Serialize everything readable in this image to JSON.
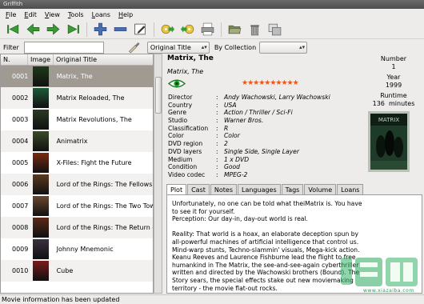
{
  "window": {
    "title": "Griffith"
  },
  "menu": [
    "File",
    "Edit",
    "View",
    "Tools",
    "Loans",
    "Help"
  ],
  "toolbar": [
    "first-icon",
    "prev-icon",
    "next-icon",
    "last-icon",
    "add-icon",
    "delete-icon",
    "edit-icon",
    "loan-icon",
    "return-icon",
    "print-icon",
    "open-folder-icon",
    "trash-icon",
    "window-icon"
  ],
  "filter": {
    "label": "Filter",
    "value": "",
    "field": "Original Title",
    "by_label": "By Collection",
    "collection": ""
  },
  "list": {
    "headers": [
      "N.",
      "Image",
      "Original Title"
    ],
    "rows": [
      {
        "num": "0001",
        "title": "Matrix, The",
        "color": "#1d3a1a"
      },
      {
        "num": "0002",
        "title": "Matrix Reloaded, The",
        "color": "#1f5a38"
      },
      {
        "num": "0003",
        "title": "Matrix Revolutions, The",
        "color": "#2a3a24"
      },
      {
        "num": "0004",
        "title": "Animatrix",
        "color": "#3a4a2a"
      },
      {
        "num": "0005",
        "title": "X-Files: Fight the Future",
        "color": "#7a2a10"
      },
      {
        "num": "0006",
        "title": "Lord of the Rings: The Fellowship",
        "color": "#5a3a20"
      },
      {
        "num": "0007",
        "title": "Lord of the Rings: The Two Towe",
        "color": "#6a4830"
      },
      {
        "num": "0008",
        "title": "Lord of the Rings: The Return of",
        "color": "#5a2a18"
      },
      {
        "num": "0009",
        "title": "Johnny Mnemonic",
        "color": "#3a3040"
      },
      {
        "num": "0010",
        "title": "Cube",
        "color": "#7a1a1a"
      }
    ]
  },
  "movie": {
    "title": "Matrix, The",
    "original_title": "Matrix, The",
    "rating_stars": "★★★★★★★★★★",
    "details": [
      {
        "k": "Director",
        "v": "Andy Wachowski, Larry Wachowski"
      },
      {
        "k": "Country",
        "v": "USA"
      },
      {
        "k": "Genre",
        "v": "Action / Thriller / Sci-Fi"
      },
      {
        "k": "Studio",
        "v": "Warner Bros."
      },
      {
        "k": "Classification",
        "v": "R"
      },
      {
        "k": "Color",
        "v": "Color"
      },
      {
        "k": "DVD region",
        "v": "2"
      },
      {
        "k": "DVD layers",
        "v": "Single Side, Single Layer"
      },
      {
        "k": "Medium",
        "v": "1 x DVD"
      },
      {
        "k": "Condition",
        "v": "Good"
      },
      {
        "k": "Video codec",
        "v": "MPEG-2"
      }
    ],
    "number_label": "Number",
    "number": "1",
    "year_label": "Year",
    "year": "1999",
    "runtime_label": "Runtime",
    "runtime": "136",
    "runtime_unit": "minutes",
    "poster_text": "MATRIX"
  },
  "tabs": [
    "Plot",
    "Cast",
    "Notes",
    "Languages",
    "Tags",
    "Volume",
    "Loans"
  ],
  "plot": {
    "p1": [
      "Unfortunately, no one can be told what theiMatrix is. You have",
      "to see it for yourself."
    ],
    "p2": "Perception: Our day-in, day-out world is real.",
    "p3": [
      "Reality: That world is a hoax, an elaborate deception spun by",
      "all-powerful machines of artificial intelligence that control us.",
      "Mind-warp stunts, Techno-slammin' visuals, Mega-kick action.",
      "Keanu Reeves and Laurence Fishburne lead the flight to free",
      "humankind in The Matrix, the see-and-see-again cyberthriller",
      "written and directed by the Wachowski brothers (Bound). The",
      "Story sears, the special effects stake out new moviemaking",
      "territory - the movie flat-out rocks."
    ]
  },
  "status": "Movie information has been updated",
  "watermark": {
    "sub": "www.xiazaiba.com"
  }
}
